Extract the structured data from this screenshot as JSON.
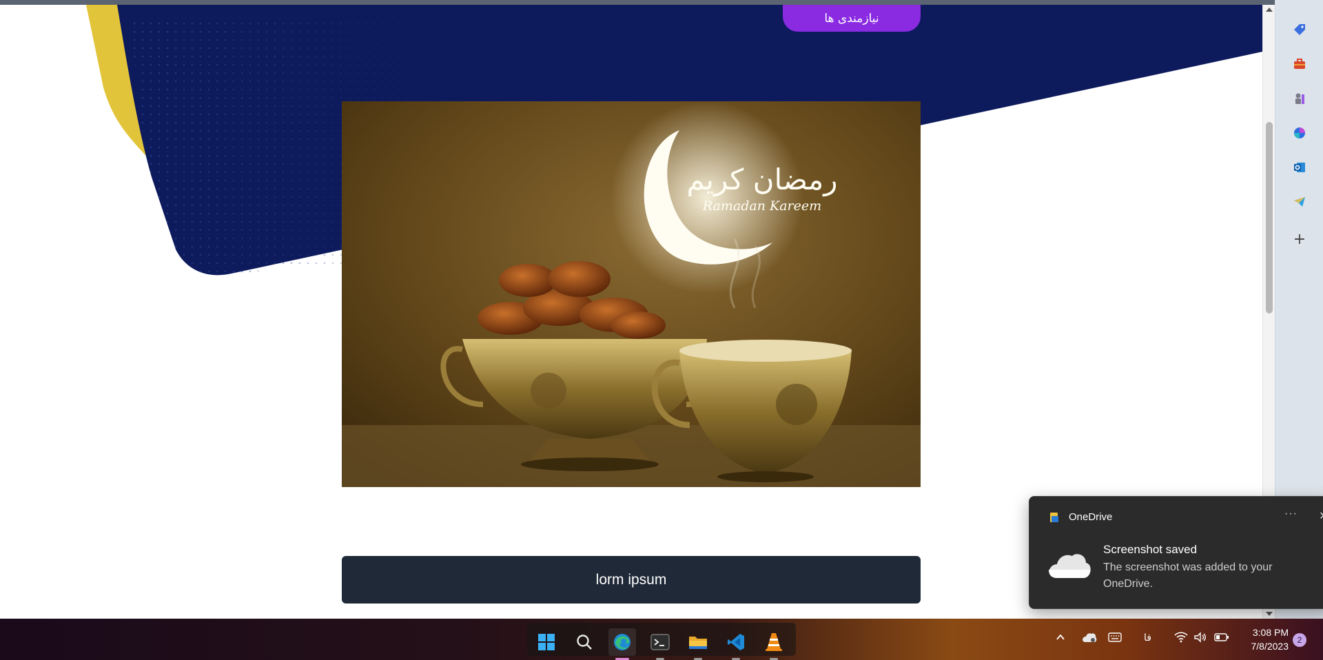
{
  "page": {
    "header_button_label": "نیازمندی ها",
    "image_alt": "Ramadan Kareem dates and cup",
    "image_text_arabic": "رمضان كريم",
    "image_text_latin": "Ramadan Kareem",
    "bottom_button_label": "lorm ipsum"
  },
  "scrollbar": {
    "position": 0.19
  },
  "sidebar": {
    "icons": [
      "tag-icon",
      "toolbox-icon",
      "chess-icon",
      "copilot-icon",
      "outlook-icon",
      "telegram-icon",
      "add-icon"
    ]
  },
  "toast": {
    "app_name": "OneDrive",
    "more": "···",
    "close": "✕",
    "title": "Screenshot saved",
    "body": "The screenshot was added to your OneDrive."
  },
  "taskbar": {
    "apps": [
      "start-icon",
      "search-icon",
      "edge-icon",
      "terminal-icon",
      "file-explorer-icon",
      "vscode-icon",
      "vlc-icon"
    ],
    "language": "فا",
    "time": "3:08 PM",
    "date": "7/8/2023",
    "notification_count": "2"
  },
  "colors": {
    "navy": "#0d1a5c",
    "yellow": "#e2c43a",
    "purple_button": "#8a2be2",
    "dark_button": "#1f2937",
    "toast_bg": "#2b2b2b"
  }
}
